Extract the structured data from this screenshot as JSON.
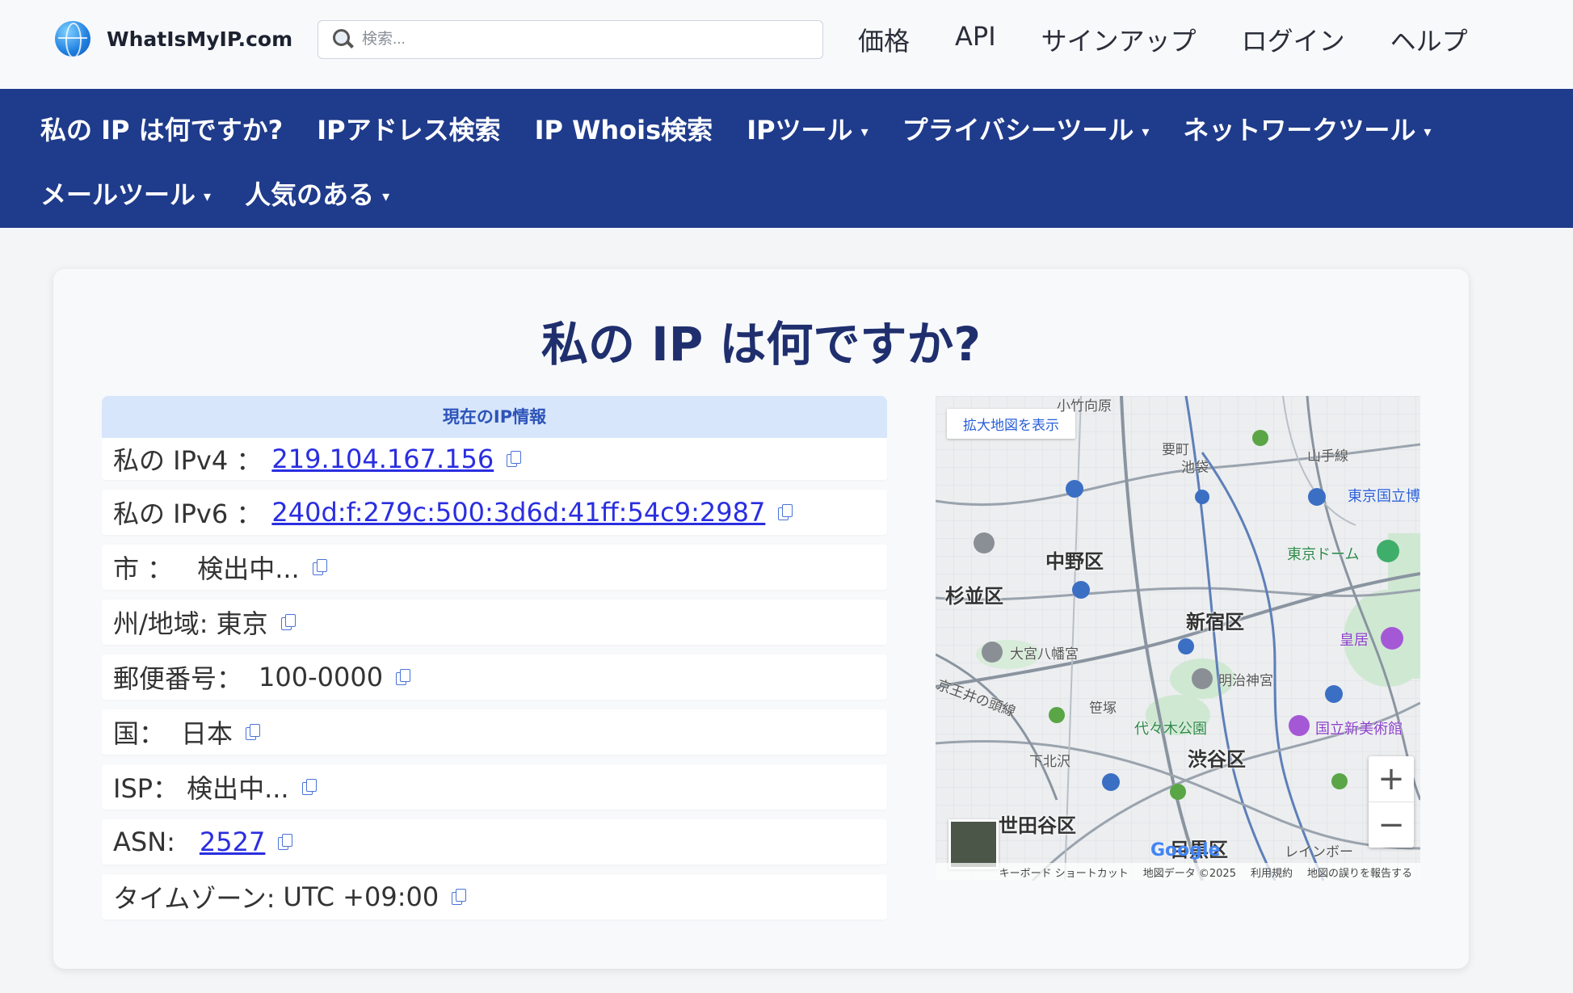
{
  "header": {
    "logo_text": "WhatIsMyIP.com",
    "search_placeholder": "検索...",
    "nav": [
      "価格",
      "API",
      "サインアップ",
      "ログイン",
      "ヘルプ"
    ]
  },
  "main_nav": {
    "row1": [
      {
        "label": "私の IP は何ですか?",
        "dropdown": false
      },
      {
        "label": "IPアドレス検索",
        "dropdown": false
      },
      {
        "label": "IP Whois検索",
        "dropdown": false
      },
      {
        "label": "IPツール",
        "dropdown": true
      },
      {
        "label": "プライバシーツール",
        "dropdown": true
      },
      {
        "label": "ネットワークツール",
        "dropdown": true
      }
    ],
    "row2": [
      {
        "label": "メールツール",
        "dropdown": true
      },
      {
        "label": "人気のある",
        "dropdown": true
      }
    ],
    "caret": "▾"
  },
  "page": {
    "title": "私の IP は何ですか?",
    "panel_title": "現在のIP情報",
    "rows": {
      "ipv4": {
        "label": "私の IPv4 ：",
        "value": "219.104.167.156"
      },
      "ipv6": {
        "label": "私の IPv6 ：",
        "value": "240d:f:279c:500:3d6d:41ff:54c9:2987"
      },
      "city": {
        "label": "市 ：",
        "value": "検出中..."
      },
      "region": {
        "label": "州/地域:",
        "value": "東京"
      },
      "postal": {
        "label": "郵便番号：",
        "value": "100-0000"
      },
      "country": {
        "label": "国：",
        "value": "日本"
      },
      "isp": {
        "label": "ISP：",
        "value": "検出中..."
      },
      "asn": {
        "label": "ASN:",
        "value": "2527"
      },
      "timezone": {
        "label": "タイムゾーン:",
        "value": "UTC +09:00"
      }
    }
  },
  "map": {
    "view_larger": "拡大地図を表示",
    "zoom_in": "+",
    "zoom_out": "−",
    "google": "Google",
    "attribution": [
      "キーボード ショートカット",
      "地図データ ©2025",
      "利用規約",
      "地図の誤りを報告する"
    ],
    "labels": {
      "nakano": "中野区",
      "suginami": "杉並区",
      "shinjuku": "新宿区",
      "shibuya": "渋谷区",
      "setagaya": "世田谷区",
      "meguro": "目黒区",
      "kanamecho": "要町",
      "ikebukuro": "池袋",
      "kotakemukaihara": "小竹向原",
      "omiya_hachimangu": "大宮八幡宮",
      "meiji_jingu": "明治神宮",
      "sasazuka": "笹塚",
      "shimokitazawa": "下北沢",
      "yoyogi_park": "代々木公園",
      "tokyo_dome": "東京ドーム",
      "kokyo": "皇居",
      "national_art_center": "国立新美術館",
      "tokyo_national_museum": "東京国立博",
      "yamanote": "山手線",
      "keio_inokashira": "京王井の頭線",
      "rainbow": "レインボー"
    }
  }
}
